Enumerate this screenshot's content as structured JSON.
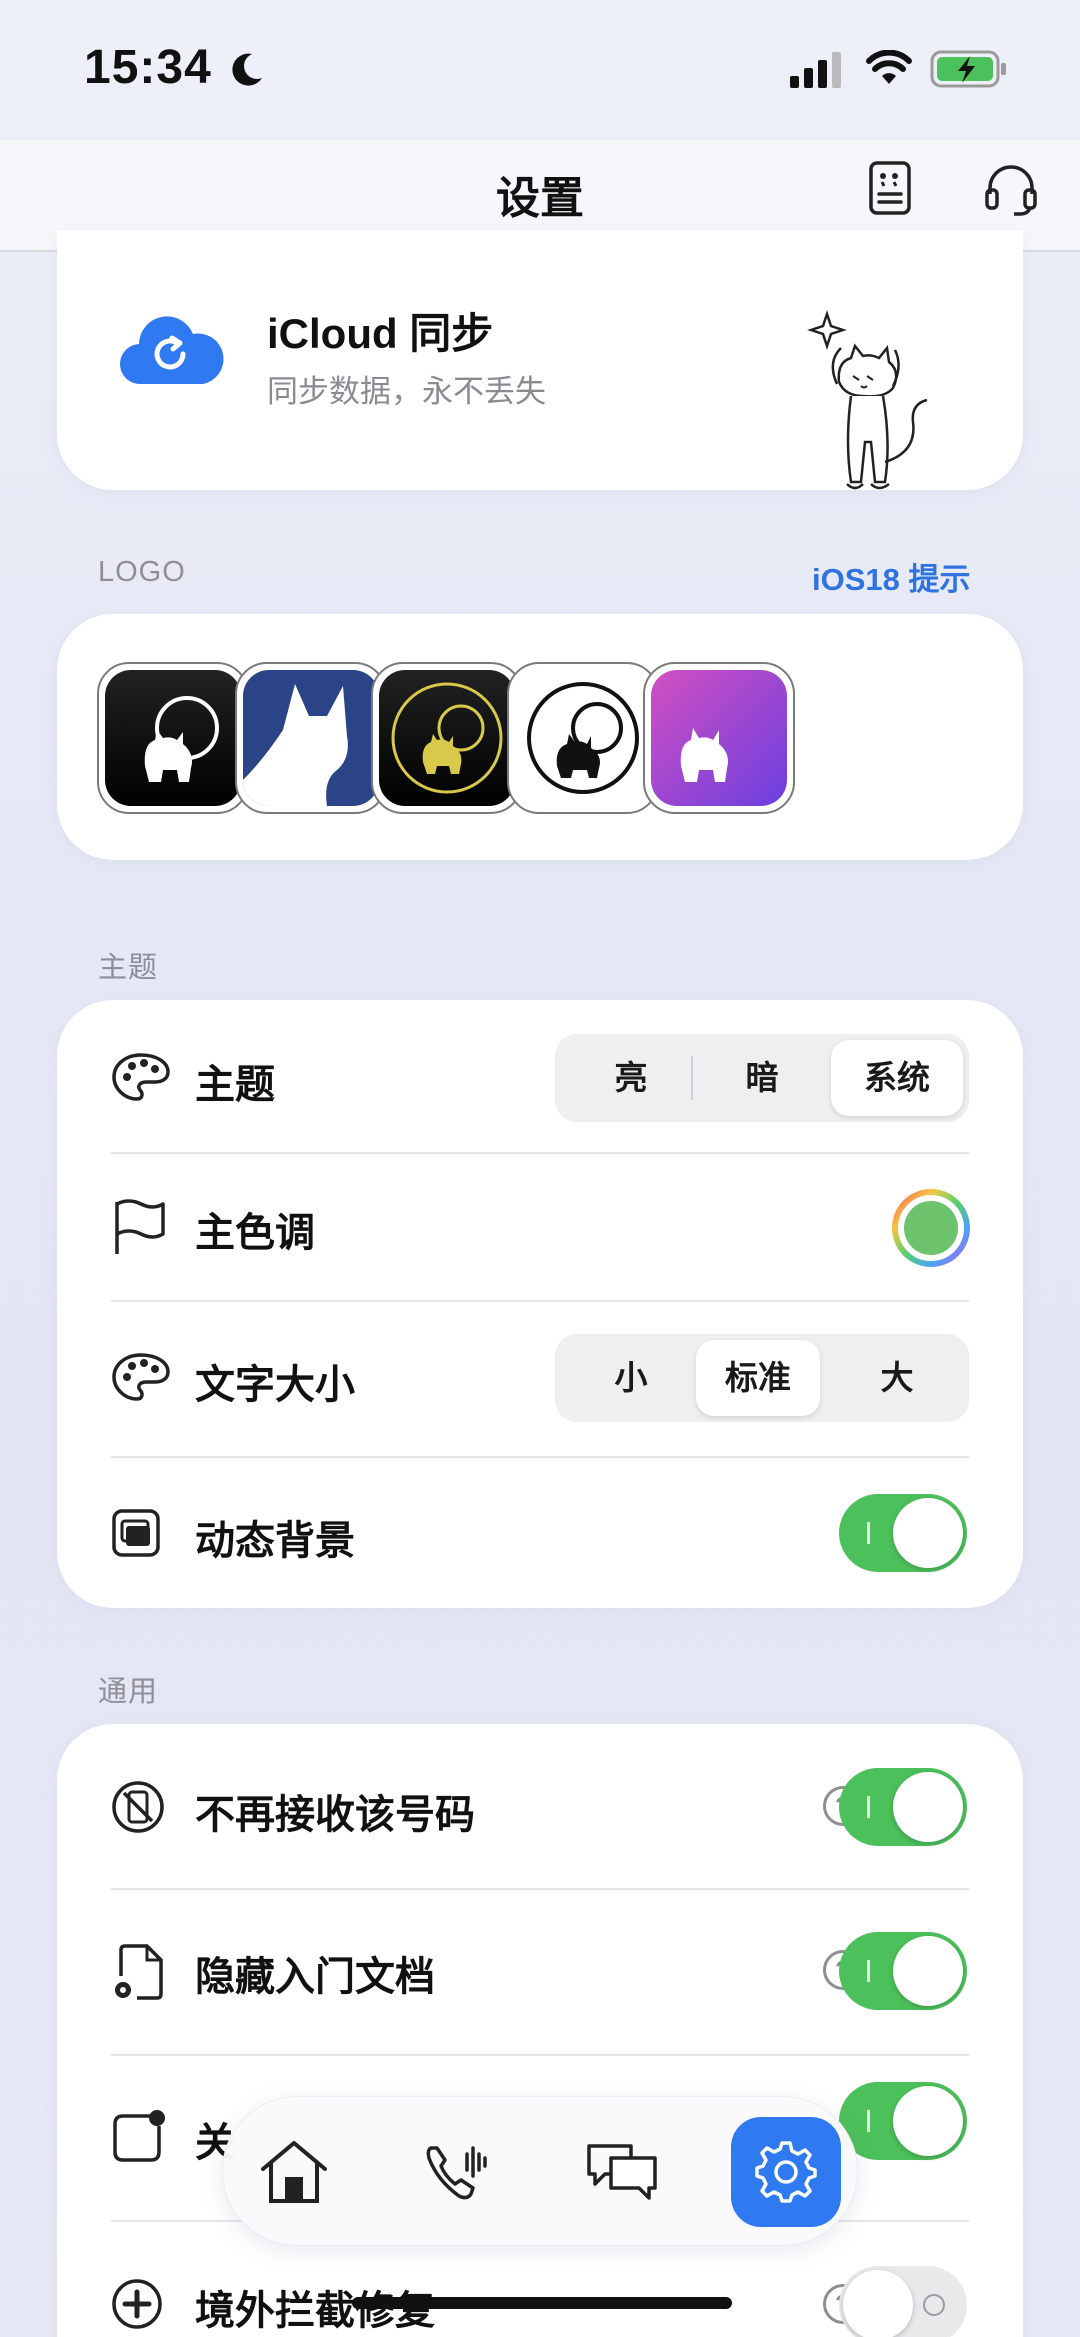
{
  "status": {
    "time": "15:34"
  },
  "nav": {
    "title": "设置"
  },
  "icloud": {
    "title": "iCloud 同步",
    "subtitle": "同步数据，永不丢失"
  },
  "logo_section": {
    "label": "LOGO",
    "link": "iOS18 提示"
  },
  "theme_section": {
    "label": "主题",
    "rows": {
      "theme": {
        "label": "主题",
        "options": [
          "亮",
          "暗",
          "系统"
        ],
        "selected": "系统"
      },
      "accent": {
        "label": "主色调",
        "color": "#6cc36b"
      },
      "font_size": {
        "label": "文字大小",
        "options": [
          "小",
          "标准",
          "大"
        ],
        "selected": "标准"
      },
      "dynamic_bg": {
        "label": "动态背景",
        "enabled": true
      }
    }
  },
  "general_section": {
    "label": "通用",
    "rows": {
      "block_number": {
        "label": "不再接收该号码",
        "help": "?",
        "enabled": true
      },
      "hide_docs": {
        "label": "隐藏入门文档",
        "help": "?",
        "enabled": true
      },
      "row3": {
        "label": "关",
        "enabled": true
      },
      "overseas": {
        "label": "境外拦截修复",
        "help": "?",
        "enabled": false
      }
    }
  },
  "tabbar": {
    "tabs": [
      "home",
      "calls",
      "messages",
      "settings"
    ],
    "active": "settings"
  },
  "colors": {
    "accent_blue": "#2f7af0",
    "toggle_green": "#4cc05b"
  }
}
